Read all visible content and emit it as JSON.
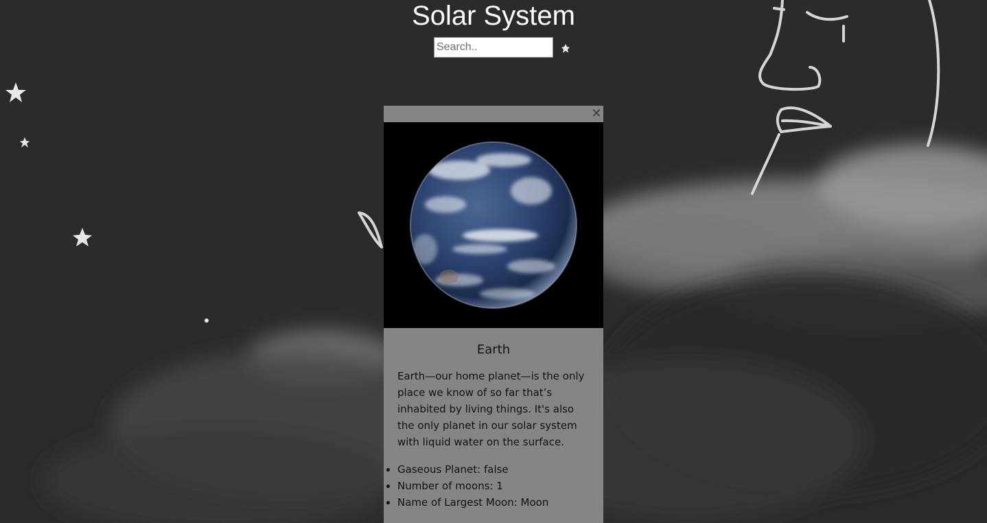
{
  "header": {
    "title": "Solar System"
  },
  "search": {
    "placeholder": "Search..",
    "value": ""
  },
  "modal": {
    "close_label": "✕",
    "planet": {
      "name": "Earth",
      "image_icon": "earth-image",
      "description": "Earth—our home planet—is the only place we know of so far that’s inhabited by living things. It's also the only planet in our solar system with liquid water on the surface.",
      "facts": [
        "Gaseous Planet: false",
        "Number of moons: 1",
        "Name of Largest Moon: Moon"
      ]
    }
  },
  "colors": {
    "background": "#2c2c2c",
    "modal_background": "#858585",
    "title_text": "#ffffff"
  }
}
